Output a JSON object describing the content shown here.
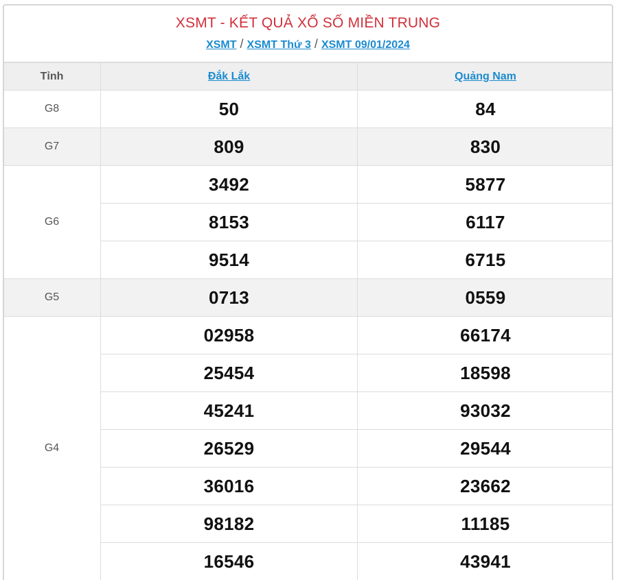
{
  "title": "XSMT - KẾT QUẢ XỔ SỐ MIỀN TRUNG",
  "breadcrumb": [
    {
      "label": "XSMT"
    },
    {
      "label": "XSMT Thứ 3"
    },
    {
      "label": "XSMT 09/01/2024"
    }
  ],
  "breadcrumb_sep": "/",
  "table": {
    "header_label": "Tỉnh",
    "provinces": [
      "Đắk Lắk",
      "Quảng Nam"
    ],
    "prizes": {
      "g8": {
        "label": "G8",
        "values": [
          [
            "50",
            "84"
          ]
        ]
      },
      "g7": {
        "label": "G7",
        "values": [
          [
            "809",
            "830"
          ]
        ]
      },
      "g6": {
        "label": "G6",
        "values": [
          [
            "3492",
            "5877"
          ],
          [
            "8153",
            "6117"
          ],
          [
            "9514",
            "6715"
          ]
        ]
      },
      "g5": {
        "label": "G5",
        "values": [
          [
            "0713",
            "0559"
          ]
        ]
      },
      "g4": {
        "label": "G4",
        "values": [
          [
            "02958",
            "66174"
          ],
          [
            "25454",
            "18598"
          ],
          [
            "45241",
            "93032"
          ],
          [
            "26529",
            "29544"
          ],
          [
            "36016",
            "23662"
          ],
          [
            "98182",
            "11185"
          ],
          [
            "16546",
            "43941"
          ]
        ]
      }
    }
  },
  "colors": {
    "title": "#d0303b",
    "link": "#1b8bd0",
    "shade": "#f2f2f2",
    "border": "#dcdcdc"
  }
}
